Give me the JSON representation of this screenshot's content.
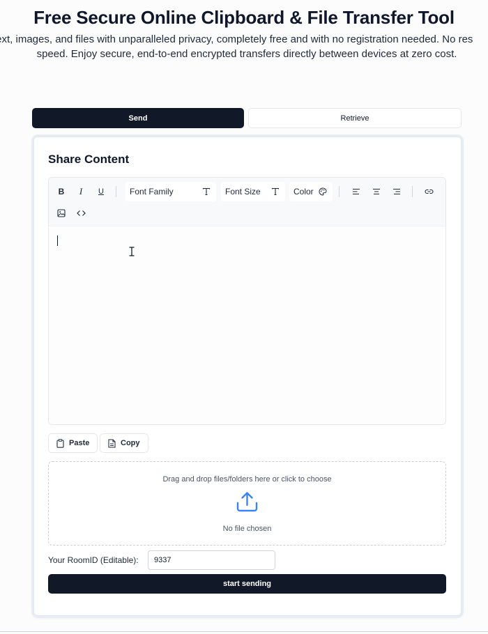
{
  "hero": {
    "title": "Free Secure Online Clipboard & File Transfer Tool",
    "subtitle_line1": "text, images, and files with unparalleled privacy, completely free and with no registration needed. No res",
    "subtitle_line2": "speed. Enjoy secure, end-to-end encrypted transfers directly between devices at zero cost."
  },
  "tabs": [
    {
      "label": "Send",
      "active": true
    },
    {
      "label": "Retrieve",
      "active": false
    }
  ],
  "share": {
    "title": "Share Content",
    "toolbar": {
      "bold": "B",
      "italic": "I",
      "underline": "U",
      "font_family": "Font Family",
      "font_size": "Font Size",
      "color": "Color"
    },
    "editor_content": "",
    "paste_label": "Paste",
    "copy_label": "Copy"
  },
  "dropzone": {
    "instruction": "Drag and drop files/folders here or click to choose",
    "status": "No file chosen"
  },
  "room": {
    "label": "Your RoomID (Editable):",
    "value": "9337"
  },
  "start_button": "start sending",
  "colors": {
    "primary": "#111827",
    "upload_icon": "#3b82f6",
    "border": "#e5e7eb"
  }
}
